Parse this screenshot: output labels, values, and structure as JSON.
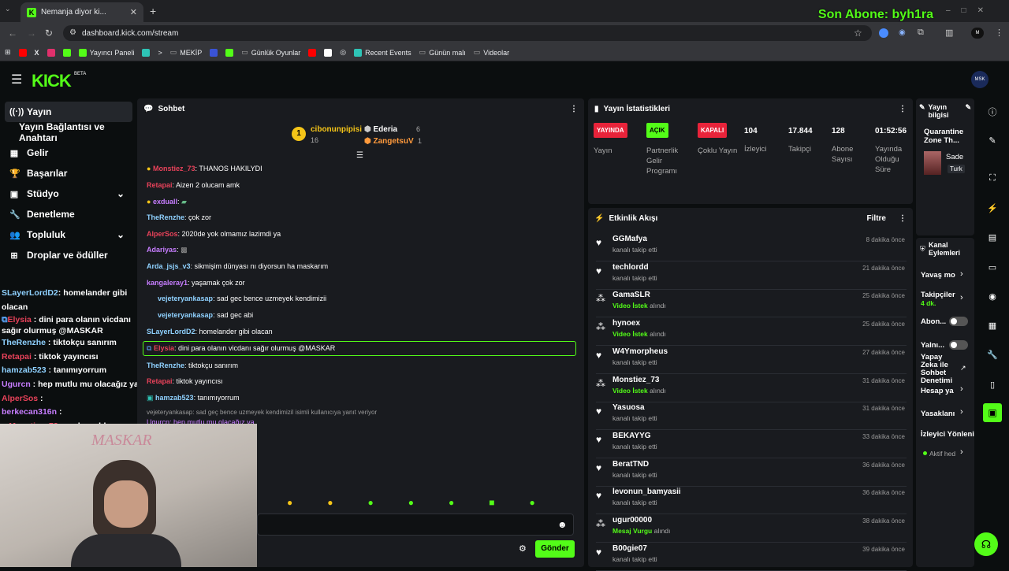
{
  "browser": {
    "tab_title": "Nemanja diyor ki...",
    "url": "dashboard.kick.com/stream",
    "bookmarks": [
      "Yayıncı Paneli",
      "MEKİP",
      "Günlük Oyunlar",
      "Recent Events",
      "Günün malı",
      "Videolar"
    ]
  },
  "overlay": {
    "last_sub": "Son Abone: byh1ra"
  },
  "brand": {
    "logo": "KICK",
    "beta": "BETA",
    "accent": "#53fc18"
  },
  "nav": [
    {
      "label": "Yayın",
      "icon": "broadcast-icon"
    },
    {
      "label": "Yayın Bağlantısı ve Anahtarı",
      "icon": ""
    },
    {
      "label": "Gelir",
      "icon": "revenue-icon"
    },
    {
      "label": "Başarılar",
      "icon": "trophy-icon"
    },
    {
      "label": "Stüdyo",
      "icon": "studio-icon"
    },
    {
      "label": "Denetleme",
      "icon": "wrench-icon"
    },
    {
      "label": "Topluluk",
      "icon": "community-icon"
    },
    {
      "label": "Droplar ve ödüller",
      "icon": "drops-icon"
    }
  ],
  "overlay_chat": [
    {
      "user": "SLayerLordD2",
      "msg": ": homelander gibi olacan",
      "color": "#8fd1ff"
    },
    {
      "user": "Elysia",
      "msg": " : dini para olanın vicdanı sağır olurmuş @MASKAR",
      "color": "#e8425a"
    },
    {
      "user": "TheRenzhe",
      "msg": " : tiktokçu sanırım",
      "color": "#8fd1ff"
    },
    {
      "user": "Retapai",
      "msg": " : tiktok yayıncısı",
      "color": "#e8425a"
    },
    {
      "user": "hamzab523",
      "msg": " : tanımıyorrum",
      "color": "#8fd1ff"
    },
    {
      "user": "Ugurcn",
      "msg": " : hep mutlu mu olacağız ya",
      "color": "#c77dff"
    },
    {
      "user": "AlperSos",
      "msg": " : ",
      "color": "#e8425a"
    },
    {
      "user": "berkecan316n",
      "msg": " : ",
      "color": "#c77dff"
    },
    {
      "user": "Monstiez_73",
      "msg": " : şarkıcı abla",
      "color": "#e8425a"
    }
  ],
  "chat": {
    "title": "Sohbet",
    "leaders": [
      {
        "name": "cibonunpipisi",
        "count": "16"
      },
      {
        "name": "Ederia",
        "count": "6"
      },
      {
        "name": "ZangetsuV",
        "count": "1"
      }
    ],
    "messages": [
      {
        "user": "Monstiez_73",
        "msg": ": THANOS HAKILYDI",
        "color": "#e8425a"
      },
      {
        "user": "Retapai",
        "msg": ": Aizen 2 olucam amk",
        "color": "#e8425a"
      },
      {
        "user": "exduall",
        "msg": ":",
        "color": "#c77dff"
      },
      {
        "user": "TheRenzhe",
        "msg": ": çok zor",
        "color": "#8fd1ff"
      },
      {
        "user": "AlperSos",
        "msg": ": 2020de yok olmamız lazimdi ya",
        "color": "#e8425a"
      },
      {
        "user": "Adariyas",
        "msg": ":",
        "color": "#c77dff"
      },
      {
        "user": "Arda_jsjs_v3",
        "msg": ": sikmişim dünyası nı diyorsun ha maskarım",
        "color": "#8fd1ff"
      },
      {
        "user": "kangaleray1",
        "msg": ": yaşamak çok zor",
        "color": "#c77dff"
      },
      {
        "user": "vejeteryankasap",
        "msg": ": sad gec bence uzmeyek kendimizii",
        "color": "#8fd1ff"
      },
      {
        "user": "vejeteryankasap",
        "msg": ": sad gec abi",
        "color": "#8fd1ff"
      },
      {
        "user": "SLayerLordD2",
        "msg": ": homelander gibi olacan",
        "color": "#8fd1ff"
      },
      {
        "user": "Elysia",
        "msg": ": dini para olanın vicdanı sağır olurmuş @MASKAR",
        "color": "#e8425a"
      },
      {
        "user": "TheRenzhe",
        "msg": ": tiktokçu sanırım",
        "color": "#8fd1ff"
      },
      {
        "user": "Retapai",
        "msg": ": tiktok yayıncısı",
        "color": "#e8425a"
      },
      {
        "user": "hamzab523",
        "msg": ": tanımıyorrum",
        "color": "#8fd1ff"
      }
    ],
    "reply_hint": "vejeteryankasap: sad geç bence uzmeyek kendimizil isimli kullanıcıya yanıt veriyor",
    "partial": "Ugurcn: hep mutlu mu olacağız ya",
    "send": "Gönder",
    "webcam_text": "MASKAR"
  },
  "stats": {
    "title": "Yayın İstatistikleri",
    "items": [
      {
        "badge": "YAYINDA",
        "badge_color": "#e8233a",
        "label": "Yayın"
      },
      {
        "badge": "AÇIK",
        "badge_color": "#53fc18",
        "label": "Partnerlik Gelir Programı"
      },
      {
        "badge": "KAPALI",
        "badge_color": "#e8233a",
        "label": "Çoklu Yayın"
      },
      {
        "value": "104",
        "label": "İzleyici"
      },
      {
        "value": "17.844",
        "label": "Takipçi"
      },
      {
        "value": "128",
        "label": "Abone Sayısı"
      },
      {
        "value": "01:52:56",
        "label": "Yayında Olduğu Süre"
      }
    ]
  },
  "activity": {
    "title": "Etkinlik Akışı",
    "filter": "Filtre",
    "items": [
      {
        "name": "GGMafya",
        "desc": "kanalı takip etti",
        "time": "8 dakika önce",
        "type": "follow"
      },
      {
        "name": "techlordd",
        "desc": "kanalı takip etti",
        "time": "21 dakika önce",
        "type": "follow"
      },
      {
        "name": "GamaSLR",
        "hl": "Video İstek",
        "desc": " alındı",
        "time": "25 dakika önce",
        "type": "reward"
      },
      {
        "name": "hynoex",
        "hl": "Video İstek",
        "desc": " alındı",
        "time": "25 dakika önce",
        "type": "reward"
      },
      {
        "name": "W4Ymorpheus",
        "desc": "kanalı takip etti",
        "time": "27 dakika önce",
        "type": "follow"
      },
      {
        "name": "Monstiez_73",
        "hl": "Video İstek",
        "desc": " alındı",
        "time": "31 dakika önce",
        "type": "reward"
      },
      {
        "name": "Yasuosa",
        "desc": "kanalı takip etti",
        "time": "31 dakika önce",
        "type": "follow"
      },
      {
        "name": "BEKAYYG",
        "desc": "kanalı takip etti",
        "time": "33 dakika önce",
        "type": "follow"
      },
      {
        "name": "BeratTND",
        "desc": "kanalı takip etti",
        "time": "36 dakika önce",
        "type": "follow"
      },
      {
        "name": "levonun_bamyasii",
        "desc": "kanalı takip etti",
        "time": "36 dakika önce",
        "type": "follow"
      },
      {
        "name": "ugur00000",
        "hl": "Mesaj Vurgu",
        "desc": " alındı",
        "time": "38 dakika önce",
        "type": "reward"
      },
      {
        "name": "B00gie07",
        "desc": "kanalı takip etti",
        "time": "39 dakika önce",
        "type": "follow"
      }
    ]
  },
  "info": {
    "title": "Yayın bilgisi",
    "stream_title": "Quarantine Zone Th...",
    "category": "Sade",
    "tag": "Turk"
  },
  "actions": {
    "title": "Kanal Eylemleri",
    "slow": "Yavaş mo",
    "followers": "Takipçiler",
    "followers_sub": "4 dk.",
    "subs": "Abon...",
    "yaln": "Yalnı...",
    "ai": "Yapay Zeka ile Sohbet Denetimi",
    "account": "Hesap ya",
    "bans": "Yasaklanı",
    "viewer": "İzleyici Yönleni",
    "active": "Aktif hed"
  }
}
